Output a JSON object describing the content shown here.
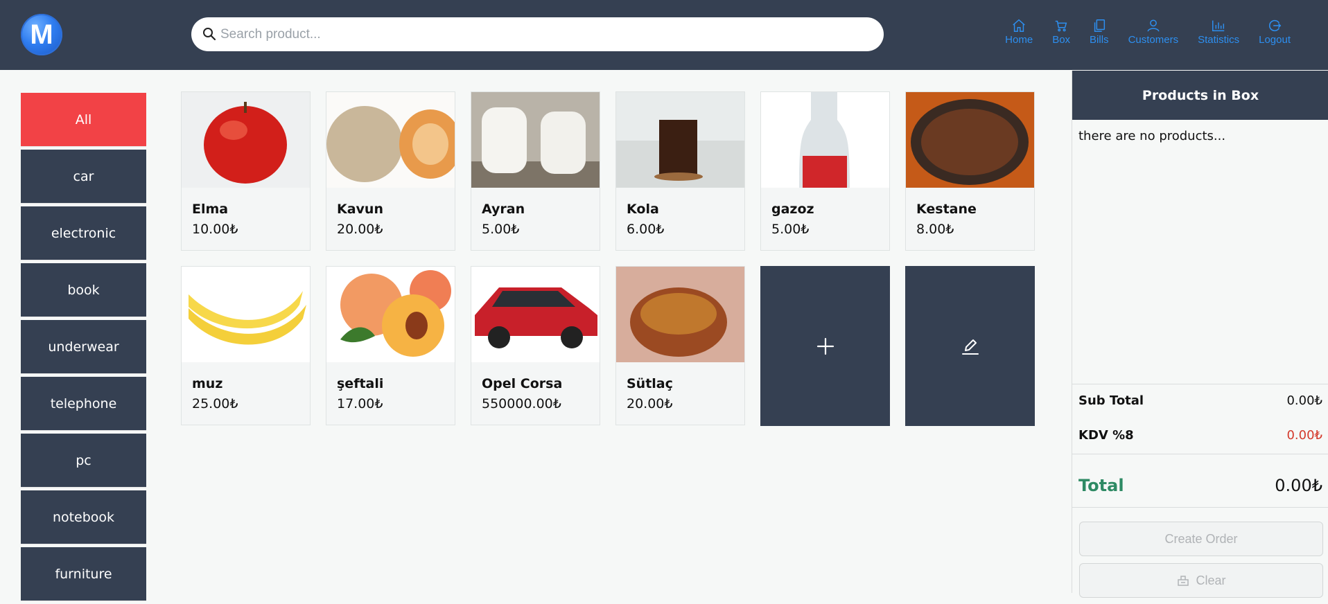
{
  "header": {
    "logo_letter": "M",
    "search_placeholder": "Search product...",
    "nav": [
      {
        "label": "Home",
        "icon": "home-icon"
      },
      {
        "label": "Box",
        "icon": "cart-icon"
      },
      {
        "label": "Bills",
        "icon": "copy-icon"
      },
      {
        "label": "Customers",
        "icon": "user-icon"
      },
      {
        "label": "Statistics",
        "icon": "bar-chart-icon"
      },
      {
        "label": "Logout",
        "icon": "logout-icon"
      }
    ],
    "nav_color": "#2d8ff0"
  },
  "categories": [
    "All",
    "car",
    "electronic",
    "book",
    "underwear",
    "telephone",
    "pc",
    "notebook",
    "furniture"
  ],
  "active_category": "All",
  "products": [
    {
      "name": "Elma",
      "price": "10.00₺"
    },
    {
      "name": "Kavun",
      "price": "20.00₺"
    },
    {
      "name": "Ayran",
      "price": "5.00₺"
    },
    {
      "name": "Kola",
      "price": "6.00₺"
    },
    {
      "name": "gazoz",
      "price": "5.00₺"
    },
    {
      "name": "Kestane",
      "price": "8.00₺"
    },
    {
      "name": "muz",
      "price": "25.00₺"
    },
    {
      "name": "şeftali",
      "price": "17.00₺"
    },
    {
      "name": "Opel Corsa",
      "price": "550000.00₺"
    },
    {
      "name": "Sütlaç",
      "price": "20.00₺"
    }
  ],
  "panel": {
    "title": "Products in Box",
    "empty_text": "there are no products...",
    "subtotal_label": "Sub Total",
    "subtotal_value": "0.00₺",
    "kdv_label": "KDV %8",
    "kdv_value": "0.00₺",
    "total_label": "Total",
    "total_value": "0.00₺",
    "create_order": "Create Order",
    "clear": "Clear"
  },
  "colors": {
    "header": "#354052",
    "active_category": "#f24246",
    "total": "#2e8a64",
    "kdv": "#d33a2c"
  }
}
